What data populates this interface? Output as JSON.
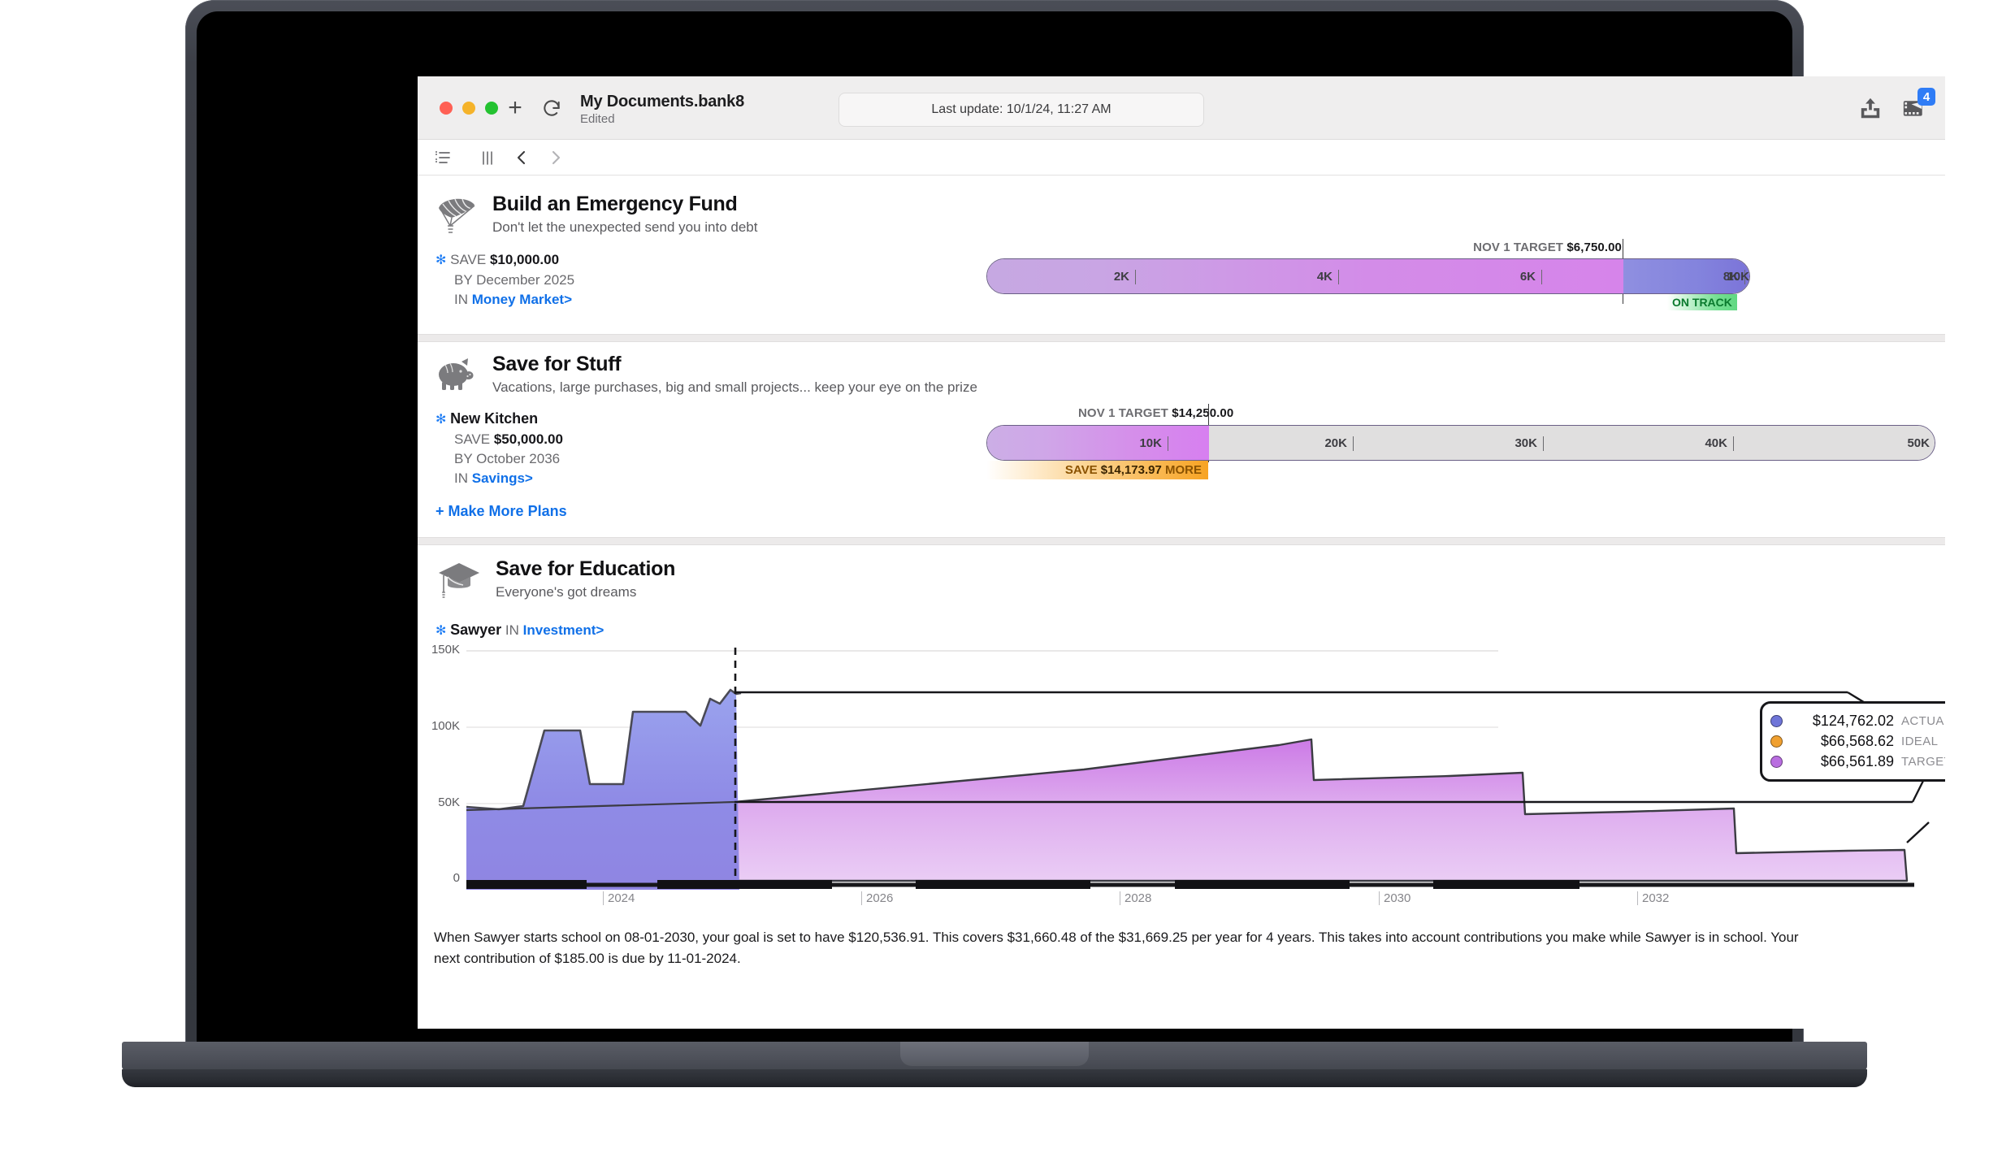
{
  "window": {
    "document_title": "My Documents.bank8",
    "document_status": "Edited",
    "last_update": "Last update: 10/1/24, 11:27 AM",
    "traffic_lights": [
      "close",
      "minimize",
      "zoom"
    ],
    "new_tab_icon": "plus-icon",
    "reload_icon": "reload-icon",
    "share_icon": "share-upload-icon",
    "media_icon": "media-icon",
    "media_badge": "4"
  },
  "toolbar": {
    "list_icon": "list-view-icon",
    "columns_icon": "columns-icon",
    "back_icon": "chevron-left-icon",
    "forward_icon": "chevron-right-icon"
  },
  "goals": [
    {
      "icon": "parachute-icon",
      "title": "Build an Emergency Fund",
      "subtitle": "Don't let the unexpected send you into debt",
      "meta": {
        "save_label": "SAVE",
        "save_amount": "$10,000.00",
        "by_label": "BY",
        "by_value": "December 2025",
        "in_label": "IN",
        "in_account": "Money Market>"
      },
      "bar": {
        "target_label": "NOV 1 TARGET",
        "target_amount": "$6,750.00",
        "ticks": [
          "2K",
          "4K",
          "6K",
          "8K",
          "10K"
        ],
        "status": "ON TRACK",
        "progress_pct": 100,
        "target_pct": 67.5,
        "max": 10000
      }
    },
    {
      "icon": "piggy-bank-icon",
      "title": "Save for Stuff",
      "subtitle": "Vacations, large purchases, big and small projects... keep your eye on the prize",
      "meta": {
        "plan_name": "New Kitchen",
        "save_label": "SAVE",
        "save_amount": "$50,000.00",
        "by_label": "BY",
        "by_value": "October 2036",
        "in_label": "IN",
        "in_account": "Savings>"
      },
      "bar": {
        "target_label": "NOV 1 TARGET",
        "target_amount": "$14,250.00",
        "ticks": [
          "10K",
          "20K",
          "30K",
          "40K",
          "50K"
        ],
        "status_prefix": "SAVE",
        "status_amount": "$14,173.97",
        "status_suffix": "MORE",
        "progress_pct": 28.5,
        "target_pct": 28.5,
        "max": 50000
      },
      "make_more_plans": "Make More Plans"
    },
    {
      "icon": "graduation-cap-icon",
      "title": "Save for Education",
      "subtitle": "Everyone's got dreams",
      "meta": {
        "plan_name": "Sawyer",
        "in_label": "IN",
        "in_account": "Investment>"
      }
    }
  ],
  "chart_data": {
    "type": "area",
    "title": "Save for Education",
    "xlabel": "",
    "ylabel": "",
    "ylim": [
      0,
      150000
    ],
    "yticks": [
      0,
      50000,
      100000,
      150000
    ],
    "ytick_labels": [
      "0",
      "50K",
      "100K",
      "150K"
    ],
    "xticks": [
      2024,
      2026,
      2028,
      2030,
      2032
    ],
    "xtick_labels": [
      "2024",
      "2026",
      "2028",
      "2030",
      "2032"
    ],
    "grid": true,
    "today_marker_year": 2024.6,
    "legend_position": "right",
    "series": [
      {
        "name": "ACTUAL",
        "color": "#6f75d8",
        "value_label": "$124,762.02",
        "points": [
          [
            2022.0,
            52000
          ],
          [
            2022.4,
            51000
          ],
          [
            2022.8,
            52500
          ],
          [
            2023.0,
            97000
          ],
          [
            2023.25,
            97000
          ],
          [
            2023.35,
            66000
          ],
          [
            2023.55,
            66000
          ],
          [
            2023.62,
            109000
          ],
          [
            2023.95,
            109000
          ],
          [
            2024.05,
            100500
          ],
          [
            2024.15,
            116500
          ],
          [
            2024.22,
            113500
          ],
          [
            2024.3,
            122000
          ],
          [
            2024.38,
            119500
          ],
          [
            2024.45,
            131000
          ],
          [
            2024.5,
            108000
          ],
          [
            2024.56,
            117500
          ],
          [
            2024.62,
            116000
          ],
          [
            2024.68,
            124762
          ]
        ]
      },
      {
        "name": "IDEAL",
        "color": "#f0a030",
        "value_label": "$66,568.62",
        "points": [
          [
            2022.0,
            51000
          ],
          [
            2024.68,
            66568
          ],
          [
            2033.1,
            66568
          ]
        ]
      },
      {
        "name": "TARGET",
        "color": "#b96ee0",
        "value_label": "$66,561.89",
        "points": [
          [
            2022.0,
            49000
          ],
          [
            2024.68,
            66561
          ],
          [
            2030.0,
            120536
          ],
          [
            2030.05,
            96000
          ],
          [
            2030.5,
            95500
          ],
          [
            2031.0,
            95000
          ],
          [
            2031.05,
            64000
          ],
          [
            2031.6,
            64500
          ],
          [
            2032.0,
            65500
          ],
          [
            2032.05,
            33000
          ],
          [
            2032.6,
            34000
          ],
          [
            2033.0,
            34500
          ],
          [
            2033.05,
            0
          ]
        ]
      }
    ]
  },
  "footnote": "When Sawyer starts school on 08-01-2030, your goal is set to have $120,536.91. This covers $31,660.48 of the $31,669.25 per year for 4 years. This takes into account contributions you make while Sawyer is in school. Your next contribution of $185.00 is due by 11-01-2024."
}
